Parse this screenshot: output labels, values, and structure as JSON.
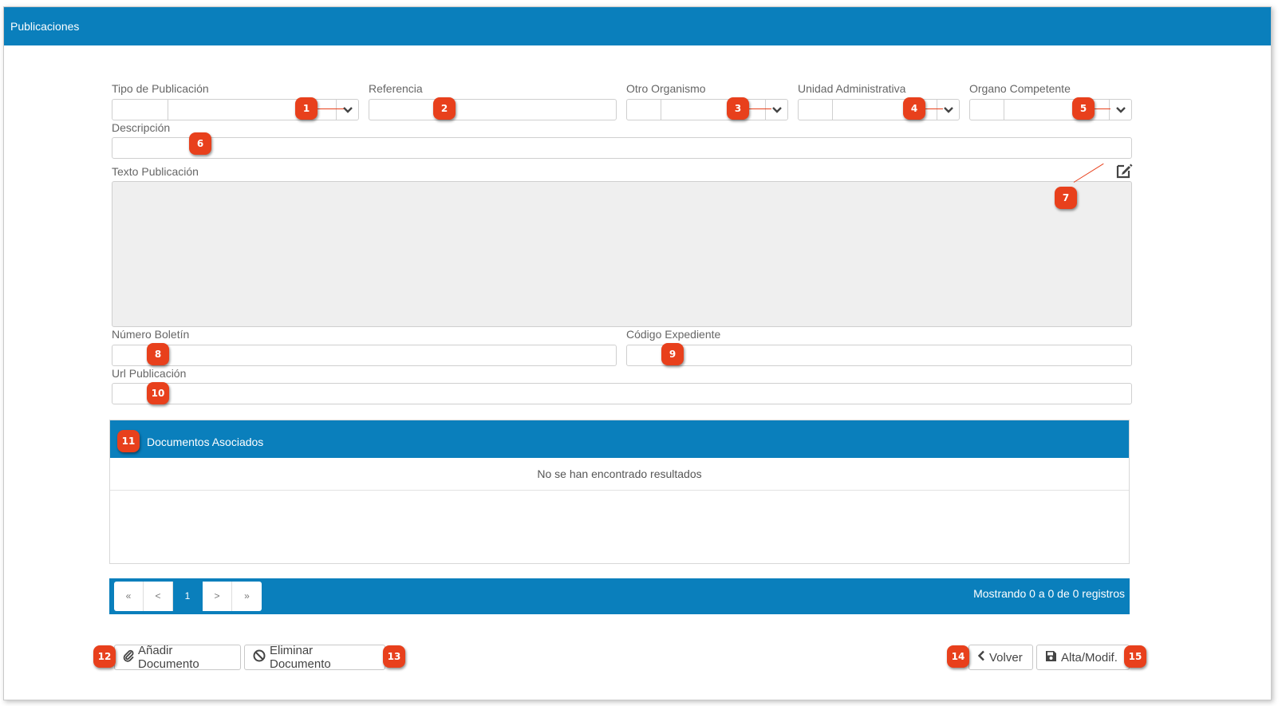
{
  "window": {
    "title": "Publicaciones"
  },
  "form": {
    "tipo_publicacion": {
      "label": "Tipo de Publicación",
      "value": ""
    },
    "referencia": {
      "label": "Referencia",
      "value": ""
    },
    "otro_organismo": {
      "label": "Otro Organismo",
      "value": ""
    },
    "unidad_administrativa": {
      "label": "Unidad Administrativa",
      "value": ""
    },
    "organo_competente": {
      "label": "Organo Competente",
      "value": ""
    },
    "descripcion": {
      "label": "Descripción",
      "value": ""
    },
    "texto_publicacion": {
      "label": "Texto Publicación",
      "edit_icon": "edit-icon"
    },
    "numero_boletin": {
      "label": "Número Boletín",
      "value": ""
    },
    "codigo_expediente": {
      "label": "Código Expediente",
      "value": ""
    },
    "url_publicacion": {
      "label": "Url Publicación",
      "value": ""
    }
  },
  "documentos": {
    "title": "Documentos Asociados",
    "empty_message": "No se han encontrado resultados",
    "pagination": {
      "first": "«",
      "prev": "<",
      "current": "1",
      "next": ">",
      "last": "»",
      "info": "Mostrando 0 a 0 de 0 registros"
    }
  },
  "buttons": {
    "add_document": "Añadir Documento",
    "delete_document": "Eliminar Documento",
    "back": "Volver",
    "save": "Alta/Modif."
  },
  "callouts": [
    "1",
    "2",
    "3",
    "4",
    "5",
    "6",
    "7",
    "8",
    "9",
    "10",
    "11",
    "12",
    "13",
    "14",
    "15"
  ],
  "colors": {
    "header": "#0a7fbc",
    "callout": "#e8401c"
  }
}
